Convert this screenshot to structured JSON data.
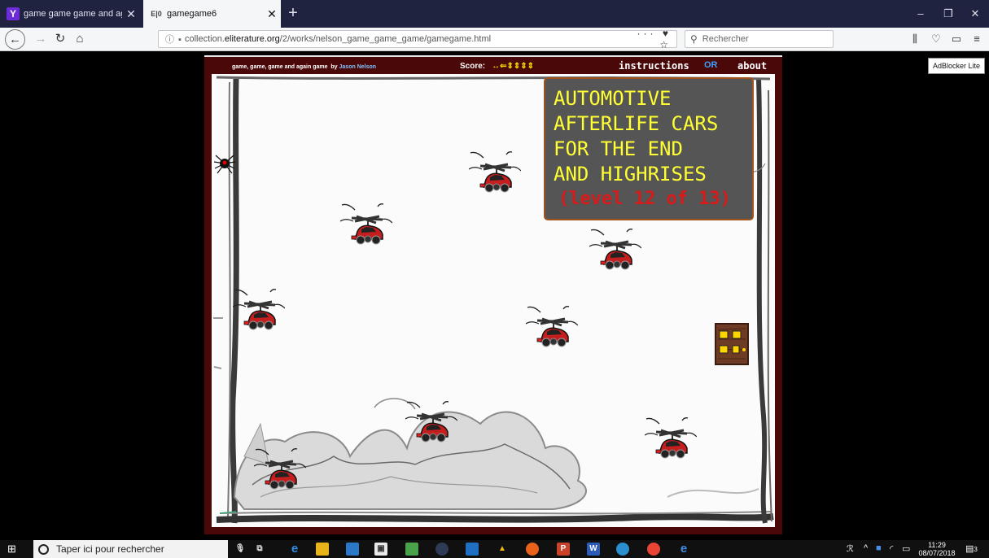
{
  "browser": {
    "tabs": [
      {
        "title": "game game game and again g",
        "favicon": "Y",
        "active": false
      },
      {
        "title": "gamegame6",
        "favicon": "E|0",
        "active": true
      }
    ],
    "new_tab_label": "+",
    "window_controls": {
      "minimize": "–",
      "restore": "❐",
      "close": "✕"
    },
    "url": {
      "prefix": "collection.",
      "domain": "eliterature.org",
      "path": "/2/works/nelson_game_game_game/gamegame.html"
    },
    "url_actions": "··· ♥ ☆",
    "search_placeholder": "Rechercher",
    "tooltip": "AdBlocker Lite"
  },
  "game": {
    "header": {
      "title": "game, game, game and again game",
      "by_label": "by",
      "author": "Jason Nelson",
      "score_label": "Score:",
      "score_glyphs": "↔⇐⇕⇕⇕⇕",
      "instructions": "instructions",
      "or": "OR",
      "about": "about"
    },
    "level_box": {
      "lines": [
        "AUTOMOTIVE",
        "AFTERLIFE CARS",
        "FOR THE END",
        "AND HIGHRISES"
      ],
      "level_text": "(level 12 of 13)"
    },
    "sprites": {
      "flying_car": "helicopter-car-icon",
      "player": "spider-icon",
      "exit": "door-icon"
    }
  },
  "taskbar": {
    "search_placeholder": "Taper ici pour rechercher",
    "clock_time": "11:29",
    "clock_date": "08/07/2018",
    "notification_count": "3"
  }
}
